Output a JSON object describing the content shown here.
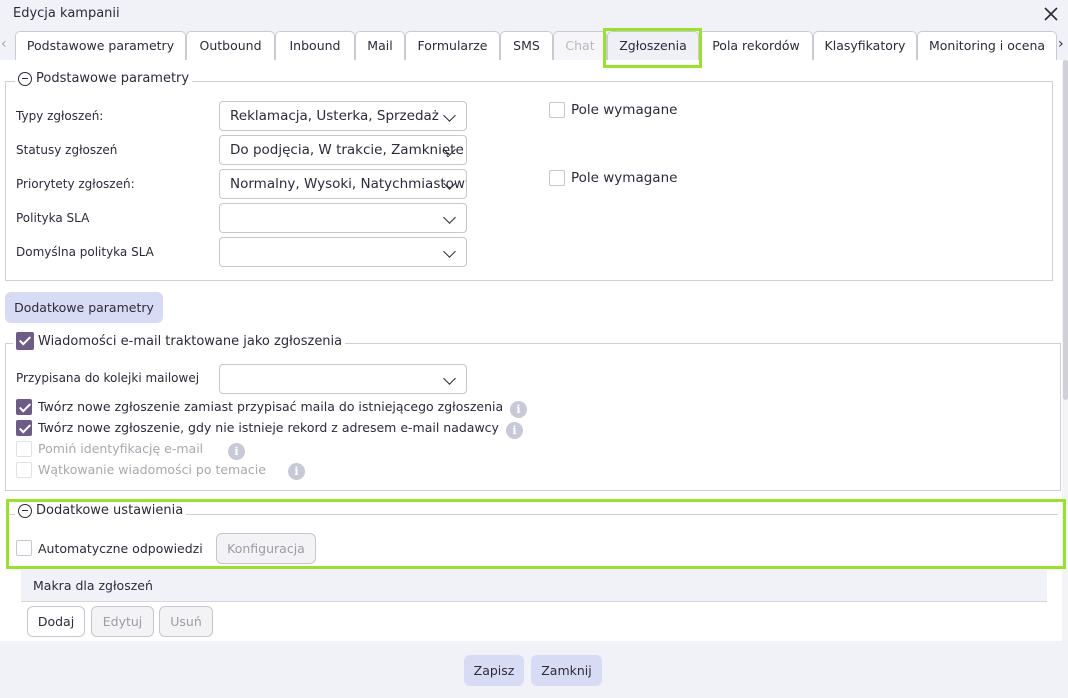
{
  "window": {
    "title": "Edycja kampanii"
  },
  "tabs": [
    {
      "label": "Podstawowe parametry",
      "state": "normal"
    },
    {
      "label": "Outbound",
      "state": "normal"
    },
    {
      "label": "Inbound",
      "state": "normal"
    },
    {
      "label": "Mail",
      "state": "normal"
    },
    {
      "label": "Formularze",
      "state": "normal"
    },
    {
      "label": "SMS",
      "state": "normal"
    },
    {
      "label": "Chat",
      "state": "disabled"
    },
    {
      "label": "Zgłoszenia",
      "state": "active"
    },
    {
      "label": "Pola rekordów",
      "state": "normal"
    },
    {
      "label": "Klasyfikatory",
      "state": "normal"
    },
    {
      "label": "Monitoring i ocena",
      "state": "normal"
    }
  ],
  "basic": {
    "legend": "Podstawowe parametry",
    "rows": [
      {
        "label": "Typy zgłoszeń:",
        "value": "Reklamacja, Usterka, Sprzedaż"
      },
      {
        "label": "Statusy zgłoszeń",
        "value": "Do podjęcia, W trakcie, Zamknięte"
      },
      {
        "label": "Priorytety zgłoszeń:",
        "value": "Normalny, Wysoki, Natychmiastowy"
      },
      {
        "label": "Polityka SLA",
        "value": ""
      },
      {
        "label": "Domyślna polityka SLA",
        "value": ""
      }
    ],
    "required_1": "Pole wymagane",
    "required_2": "Pole wymagane"
  },
  "extra_params_button": "Dodatkowe parametry",
  "email_section": {
    "legend": "Wiadomości e-mail traktowane jako zgłoszenia",
    "queue_label": "Przypisana do kolejki mailowej",
    "queue_value": "",
    "options": [
      {
        "label": "Twórz nowe zgłoszenie zamiast przypisać maila do istniejącego zgłoszenia",
        "checked": true,
        "disabled": false
      },
      {
        "label": "Twórz nowe zgłoszenie, gdy nie istnieje rekord z adresem e-mail nadawcy",
        "checked": true,
        "disabled": false
      },
      {
        "label": "Pomiń identyfikację e-mail",
        "checked": false,
        "disabled": true
      },
      {
        "label": "Wątkowanie wiadomości po temacie",
        "checked": false,
        "disabled": true
      }
    ],
    "info_glyph": "i"
  },
  "additional": {
    "legend": "Dodatkowe ustawienia",
    "auto_reply_label": "Automatyczne odpowiedzi",
    "config_button": "Konfiguracja"
  },
  "macros": {
    "title": "Makra dla zgłoszeń",
    "add": "Dodaj",
    "edit": "Edytuj",
    "remove": "Usuń"
  },
  "footer": {
    "save": "Zapisz",
    "close": "Zamknij"
  },
  "colors": {
    "highlight": "#9be02e",
    "accent": "#6d5c86",
    "button": "#d8dbf4"
  }
}
